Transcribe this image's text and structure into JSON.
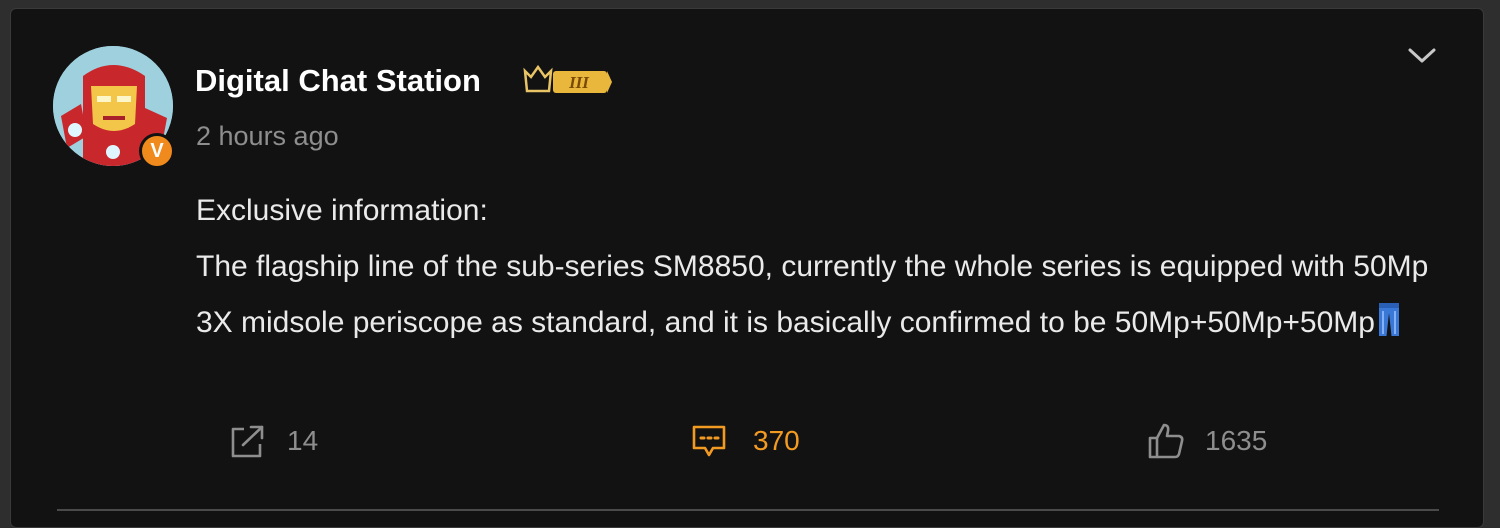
{
  "post": {
    "username": "Digital Chat Station",
    "rank_badge": "III",
    "verified_badge": "V",
    "timestamp": "2 hours ago",
    "text_line1": "Exclusive information:",
    "text_line2": "The flagship line of the sub-series SM8850, currently the whole series is equipped with 50Mp 3X midsole periscope as standard, and it is basically confirmed to be 50Mp+50Mp+50Mp",
    "emoji": "jeans-emoji"
  },
  "actions": {
    "repost_count": "14",
    "comment_count": "370",
    "like_count": "1635"
  },
  "colors": {
    "background": "#121212",
    "text": "#eaeaea",
    "muted": "#8e8e8e",
    "accent": "#f39a22",
    "verified": "#f08a1c"
  },
  "icons": {
    "menu": "chevron-down-icon",
    "repost": "repost-icon",
    "comment": "comment-icon",
    "like": "thumbs-up-icon"
  }
}
